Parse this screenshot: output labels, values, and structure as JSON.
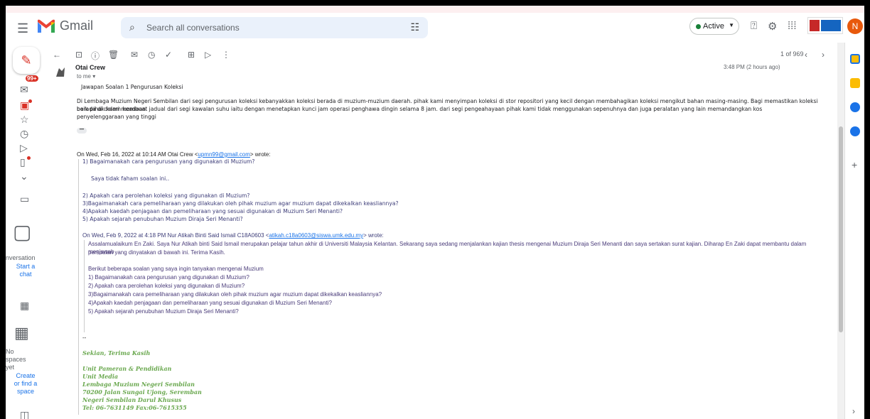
{
  "header": {
    "brand": "Gmail",
    "search_placeholder": "Search all conversations",
    "status_label": "Active",
    "avatar_letter": "N",
    "colors": {
      "red": "#ea4335",
      "blue": "#4285f4",
      "green": "#34a853",
      "yellow": "#fbbc04"
    }
  },
  "rail": {
    "badge": "99+",
    "conversation_label": "nversation",
    "start_chat_1": "Start a",
    "start_chat_2": "chat",
    "spaces_1": "No",
    "spaces_2": "spaces",
    "spaces_3": "yet",
    "create_1": "Create",
    "create_2": "or find a",
    "create_3": "space"
  },
  "toolbar": {
    "pager": "1 of 969"
  },
  "message": {
    "sender": "Otai Crew",
    "to": "to me ▾",
    "date": "3:48 PM (2 hours ago)",
    "subject_line": "Jawapan Soalan 1 Pengurusan Koleksi",
    "body_1": "Di Lembaga Muzium Negeri Sembilan dari segi pengurusan koleksi kebanyakkan koleksi berada di muzium-muzium daerah. pihak kami menyimpan koleksi di stor repositori yang kecil dengan membahagikan koleksi mengikut bahan masing-masing. Bagi memastikan koleksi berada di dalam keadaan",
    "body_2": "baik pihak kami membuat jadual dari segi kawalan suhu iaitu dengan menetapkan kunci jam operasi penghawa dingin selama 8 jam. dari segi pengeahayaan pihak kami tidak menggunakan sepenuhnya dan juga peralatan yang lain memandangkan kos",
    "body_3": "penyelenggaraan yang tinggi",
    "ellipsis": "•••",
    "quote1_header_pre": "On Wed, Feb 16, 2022 at 10:14 AM Otai Crew <",
    "quote1_email": "upmn99@gmail.com",
    "quote1_header_post": "> wrote:",
    "q1_line1": "1) Bagaimanakah cara pengurusan yang digunakan di Muzium?",
    "q1_reply": "Saya tidak faham soalan ini..",
    "q1_line2": "2) Apakah cara perolehan koleksi yang digunakan di Muzium?",
    "q1_line3": "3)Bagaimanakah cara pemeliharaan yang dilakukan oleh pihak muzium agar muzium dapat dikekalkan keasliannya?",
    "q1_line4": "4)Apakah kaedah penjagaan dan pemeliharaan yang sesuai digunakan di Muzium Seri Menanti?",
    "q1_line5": "5) Apakah sejarah penubuhan Muzium Diraja Seri Menanti?",
    "quote2_header_pre": "On Wed, Feb 9, 2022 at 4:18 PM Nur Atikah Binti Said Ismail C18A0603 <",
    "quote2_email": "atikah.c18a0603@siswa.umk.edu.my",
    "quote2_header_post": "> wrote:",
    "q2_para1": "Assalamualaikum En Zaki. Saya Nur Atikah binti Said Ismail merupakan pelajar tahun akhir di Universiti Malaysia Kelantan. Sekarang saya sedang menjalankan kajian thesis mengenai Muzium Diraja Seri Menanti dan saya sertakan surat kajian. Diharap En Zaki dapat membantu dalam menjawab",
    "q2_para2": "persoalan yang dinyatakan di bawah ini. Terima Kasih.",
    "q2_intro": "Berikut beberapa soalan yang saya ingin tanyakan mengenai Muzium",
    "q2_line1": "1) Bagaimanakah cara pengurusan yang digunakan di Muzium?",
    "q2_line2": "2) Apakah cara perolehan koleksi yang digunakan di Muzium?",
    "q2_line3": "3)Bagaimanakah cara pemeliharaan yang dilakukan oleh pihak muzium agar muzium dapat dikekalkan keasliannya?",
    "q2_line4": "4)Apakah kaedah penjagaan dan pemeliharaan yang sesuai digunakan di Muzium Seri Menanti?",
    "q2_line5": "5) Apakah sejarah penubuhan Muzium Diraja Seri Menanti?",
    "sig_dash": "--",
    "sig_1": "Sekian, Terima Kasih",
    "sig_2": "Unit Pameran & Pendidikan",
    "sig_3": "Unit Media",
    "sig_4": "Lembaga Muzium Negeri Sembilan",
    "sig_5": "70200 Jalan Sungai Ujong, Seremban",
    "sig_6": "Negeri Sembilan Darul Khusus",
    "sig_7": "Tel: 06-7631149 Fax:06-7615355"
  }
}
